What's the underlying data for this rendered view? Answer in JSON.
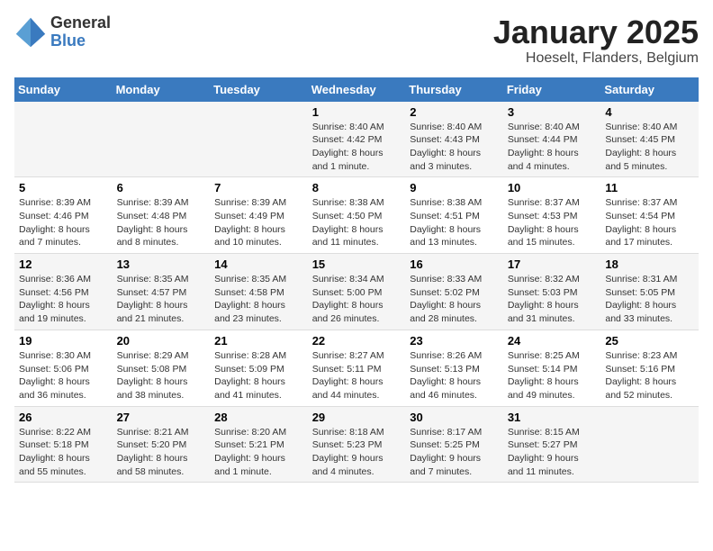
{
  "logo": {
    "general": "General",
    "blue": "Blue"
  },
  "title": "January 2025",
  "location": "Hoeselt, Flanders, Belgium",
  "days_of_week": [
    "Sunday",
    "Monday",
    "Tuesday",
    "Wednesday",
    "Thursday",
    "Friday",
    "Saturday"
  ],
  "weeks": [
    [
      {
        "num": "",
        "info": ""
      },
      {
        "num": "",
        "info": ""
      },
      {
        "num": "",
        "info": ""
      },
      {
        "num": "1",
        "info": "Sunrise: 8:40 AM\nSunset: 4:42 PM\nDaylight: 8 hours and 1 minute."
      },
      {
        "num": "2",
        "info": "Sunrise: 8:40 AM\nSunset: 4:43 PM\nDaylight: 8 hours and 3 minutes."
      },
      {
        "num": "3",
        "info": "Sunrise: 8:40 AM\nSunset: 4:44 PM\nDaylight: 8 hours and 4 minutes."
      },
      {
        "num": "4",
        "info": "Sunrise: 8:40 AM\nSunset: 4:45 PM\nDaylight: 8 hours and 5 minutes."
      }
    ],
    [
      {
        "num": "5",
        "info": "Sunrise: 8:39 AM\nSunset: 4:46 PM\nDaylight: 8 hours and 7 minutes."
      },
      {
        "num": "6",
        "info": "Sunrise: 8:39 AM\nSunset: 4:48 PM\nDaylight: 8 hours and 8 minutes."
      },
      {
        "num": "7",
        "info": "Sunrise: 8:39 AM\nSunset: 4:49 PM\nDaylight: 8 hours and 10 minutes."
      },
      {
        "num": "8",
        "info": "Sunrise: 8:38 AM\nSunset: 4:50 PM\nDaylight: 8 hours and 11 minutes."
      },
      {
        "num": "9",
        "info": "Sunrise: 8:38 AM\nSunset: 4:51 PM\nDaylight: 8 hours and 13 minutes."
      },
      {
        "num": "10",
        "info": "Sunrise: 8:37 AM\nSunset: 4:53 PM\nDaylight: 8 hours and 15 minutes."
      },
      {
        "num": "11",
        "info": "Sunrise: 8:37 AM\nSunset: 4:54 PM\nDaylight: 8 hours and 17 minutes."
      }
    ],
    [
      {
        "num": "12",
        "info": "Sunrise: 8:36 AM\nSunset: 4:56 PM\nDaylight: 8 hours and 19 minutes."
      },
      {
        "num": "13",
        "info": "Sunrise: 8:35 AM\nSunset: 4:57 PM\nDaylight: 8 hours and 21 minutes."
      },
      {
        "num": "14",
        "info": "Sunrise: 8:35 AM\nSunset: 4:58 PM\nDaylight: 8 hours and 23 minutes."
      },
      {
        "num": "15",
        "info": "Sunrise: 8:34 AM\nSunset: 5:00 PM\nDaylight: 8 hours and 26 minutes."
      },
      {
        "num": "16",
        "info": "Sunrise: 8:33 AM\nSunset: 5:02 PM\nDaylight: 8 hours and 28 minutes."
      },
      {
        "num": "17",
        "info": "Sunrise: 8:32 AM\nSunset: 5:03 PM\nDaylight: 8 hours and 31 minutes."
      },
      {
        "num": "18",
        "info": "Sunrise: 8:31 AM\nSunset: 5:05 PM\nDaylight: 8 hours and 33 minutes."
      }
    ],
    [
      {
        "num": "19",
        "info": "Sunrise: 8:30 AM\nSunset: 5:06 PM\nDaylight: 8 hours and 36 minutes."
      },
      {
        "num": "20",
        "info": "Sunrise: 8:29 AM\nSunset: 5:08 PM\nDaylight: 8 hours and 38 minutes."
      },
      {
        "num": "21",
        "info": "Sunrise: 8:28 AM\nSunset: 5:09 PM\nDaylight: 8 hours and 41 minutes."
      },
      {
        "num": "22",
        "info": "Sunrise: 8:27 AM\nSunset: 5:11 PM\nDaylight: 8 hours and 44 minutes."
      },
      {
        "num": "23",
        "info": "Sunrise: 8:26 AM\nSunset: 5:13 PM\nDaylight: 8 hours and 46 minutes."
      },
      {
        "num": "24",
        "info": "Sunrise: 8:25 AM\nSunset: 5:14 PM\nDaylight: 8 hours and 49 minutes."
      },
      {
        "num": "25",
        "info": "Sunrise: 8:23 AM\nSunset: 5:16 PM\nDaylight: 8 hours and 52 minutes."
      }
    ],
    [
      {
        "num": "26",
        "info": "Sunrise: 8:22 AM\nSunset: 5:18 PM\nDaylight: 8 hours and 55 minutes."
      },
      {
        "num": "27",
        "info": "Sunrise: 8:21 AM\nSunset: 5:20 PM\nDaylight: 8 hours and 58 minutes."
      },
      {
        "num": "28",
        "info": "Sunrise: 8:20 AM\nSunset: 5:21 PM\nDaylight: 9 hours and 1 minute."
      },
      {
        "num": "29",
        "info": "Sunrise: 8:18 AM\nSunset: 5:23 PM\nDaylight: 9 hours and 4 minutes."
      },
      {
        "num": "30",
        "info": "Sunrise: 8:17 AM\nSunset: 5:25 PM\nDaylight: 9 hours and 7 minutes."
      },
      {
        "num": "31",
        "info": "Sunrise: 8:15 AM\nSunset: 5:27 PM\nDaylight: 9 hours and 11 minutes."
      },
      {
        "num": "",
        "info": ""
      }
    ]
  ]
}
